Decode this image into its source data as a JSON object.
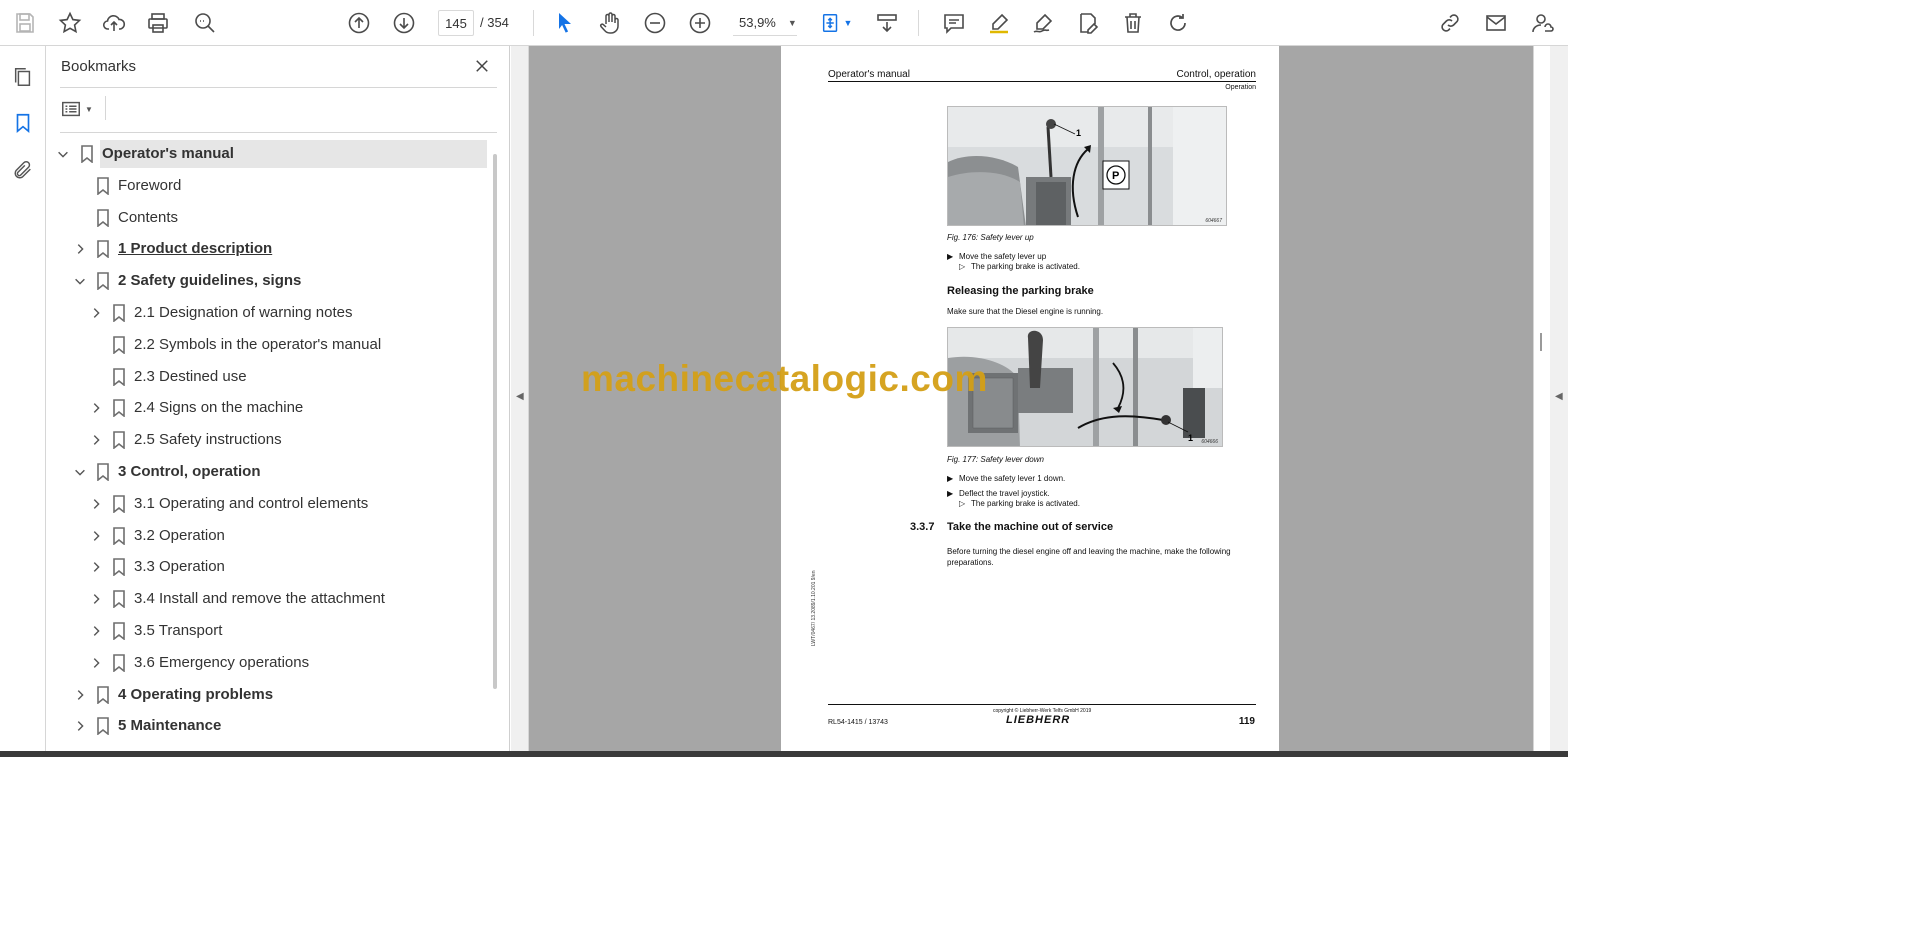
{
  "toolbar": {
    "page_current": "145",
    "page_total": "/  354",
    "zoom": "53,9%",
    "colors": {
      "select_active": "#1473e6",
      "icon": "#4b4b4b"
    }
  },
  "bookmarks": {
    "title": "Bookmarks",
    "items": [
      {
        "label": "Operator's manual",
        "level": 0,
        "chevron": "down",
        "bold": true,
        "selected": true
      },
      {
        "label": "Foreword",
        "level": 1,
        "chevron": "none"
      },
      {
        "label": "Contents",
        "level": 1,
        "chevron": "none"
      },
      {
        "label": "1 Product description",
        "level": 1,
        "chevron": "right",
        "bold": true,
        "underline": true
      },
      {
        "label": "2 Safety guidelines, signs",
        "level": 1,
        "chevron": "down",
        "bold": true
      },
      {
        "label": "2.1 Designation of warning notes",
        "level": 2,
        "chevron": "right"
      },
      {
        "label": "2.2 Symbols in the operator's manual",
        "level": 2,
        "chevron": "none"
      },
      {
        "label": "2.3 Destined use",
        "level": 2,
        "chevron": "none"
      },
      {
        "label": "2.4 Signs on the machine",
        "level": 2,
        "chevron": "right"
      },
      {
        "label": "2.5 Safety instructions",
        "level": 2,
        "chevron": "right"
      },
      {
        "label": "3 Control, operation",
        "level": 1,
        "chevron": "down",
        "bold": true
      },
      {
        "label": "3.1 Operating and control elements",
        "level": 2,
        "chevron": "right"
      },
      {
        "label": "3.2 Operation",
        "level": 2,
        "chevron": "right"
      },
      {
        "label": "3.3 Operation",
        "level": 2,
        "chevron": "right"
      },
      {
        "label": "3.4 Install and remove the attachment",
        "level": 2,
        "chevron": "right"
      },
      {
        "label": "3.5 Transport",
        "level": 2,
        "chevron": "right"
      },
      {
        "label": "3.6 Emergency operations",
        "level": 2,
        "chevron": "right"
      },
      {
        "label": "4 Operating problems",
        "level": 1,
        "chevron": "right",
        "bold": true
      },
      {
        "label": "5 Maintenance",
        "level": 1,
        "chevron": "right",
        "bold": true
      }
    ]
  },
  "document": {
    "header_left": "Operator's manual",
    "header_right": "Control, operation",
    "header_sub": "Operation",
    "fig1_code": "604667",
    "fig1_caption": "Fig. 176: Safety lever up",
    "fig1_callout": "1",
    "fig1_symbol": "P",
    "step1": "Move the safety lever up",
    "step1_result": "The parking brake is activated.",
    "heading_release": "Releasing the parking brake",
    "para_release": "Make sure that the Diesel engine is running.",
    "fig2_code": "604666",
    "fig2_caption": "Fig. 177: Safety lever down",
    "fig2_callout": "1",
    "step2a": "Move the safety lever 1 down.",
    "step2b": "Deflect the travel joystick.",
    "step2_result": "The parking brake is activated.",
    "section_number": "3.3.7",
    "section_title": "Take the machine out of service",
    "para_service": "Before turning the diesel engine off and leaving the machine, make the following preparations.",
    "side_code": "LWT/0467/ 13.2089/1.10.201 9/en",
    "footer_left": "RL54-1415 / 13743",
    "footer_copy": "copyright © Liebherr-Werk Telfs GmbH 2019",
    "footer_logo": "LIEBHERR",
    "page_number": "119",
    "watermark": "machinecatalogic.com",
    "colors": {
      "watermark": "#d4a017",
      "viewer_bg": "#a6a6a6"
    }
  }
}
